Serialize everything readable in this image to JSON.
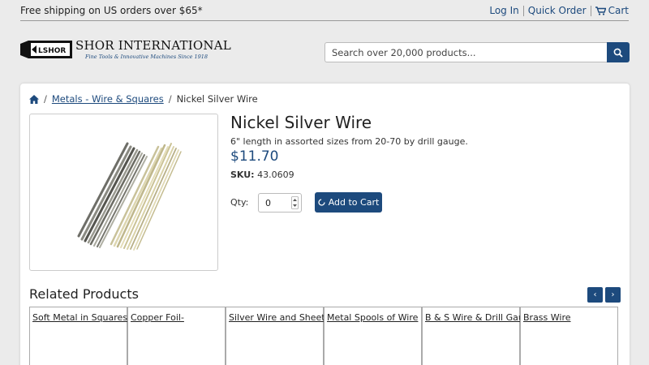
{
  "topbar": {
    "shipping_text": "Free shipping on US orders over $65*",
    "login": "Log In",
    "quick_order": "Quick Order",
    "cart": "Cart"
  },
  "header": {
    "logo_badge_text": "LSHOR",
    "logo_name": "SHOR INTERNATIONAL",
    "logo_tagline": "Fine Tools & Innovative Machines Since 1918",
    "search_placeholder": "Search over 20,000 products..."
  },
  "breadcrumb": {
    "category": "Metals - Wire & Squares",
    "current": "Nickel Silver Wire"
  },
  "product": {
    "title": "Nickel Silver Wire",
    "description": "6\" length in assorted sizes from 20-70 by drill gauge.",
    "price": "$11.70",
    "sku_label": "SKU:",
    "sku_value": "43.0609",
    "qty_label": "Qty:",
    "qty_value": "0",
    "add_to_cart": "Add to Cart"
  },
  "related": {
    "title": "Related Products",
    "prev": "‹",
    "next": "›",
    "items": [
      "Soft Metal in Squares",
      "Copper Foil-",
      "Silver Wire and Sheet",
      "Metal Spools of Wire",
      "B & S Wire & Drill Gauge",
      "Brass Wire"
    ]
  },
  "colors": {
    "brand_blue": "#1d4a7d",
    "page_bg": "#ebebeb"
  }
}
